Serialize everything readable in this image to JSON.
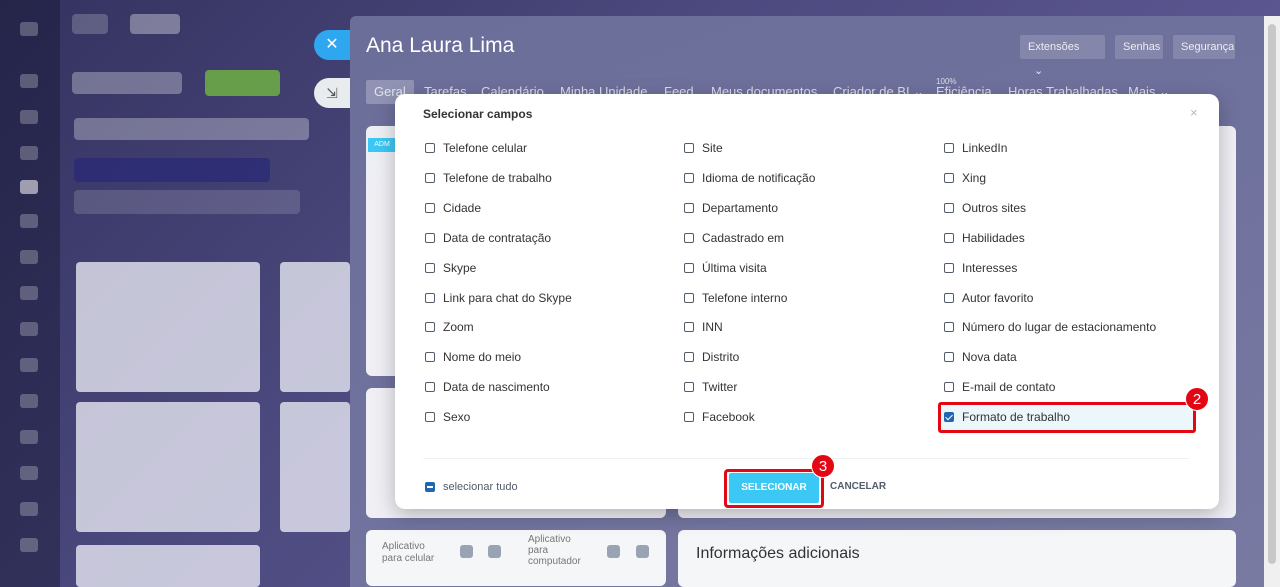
{
  "user": {
    "name": "Ana Laura Lima"
  },
  "header_buttons": {
    "extensoes": "Extensões",
    "extensoes_arrow": "⌄",
    "senhas": "Senhas",
    "seguranca": "Segurança"
  },
  "tabs": [
    "Geral",
    "Tarefas",
    "Calendário",
    "Minha Unidade",
    "Feed",
    "Meus documentos",
    "Criador de BI ⌄",
    "Eficiência",
    "Horas Trabalhadas",
    "Mais ⌄"
  ],
  "efficiency_pct": "100%",
  "admin_badge": "ADM",
  "apps": {
    "mobile": "Aplicativo para celular",
    "desktop": "Aplicativo para computador"
  },
  "info_title": "Informações adicionais",
  "modal": {
    "title": "Selecionar campos",
    "close": "×",
    "columns": [
      [
        {
          "label": "Telefone celular",
          "checked": false
        },
        {
          "label": "Telefone de trabalho",
          "checked": false
        },
        {
          "label": "Cidade",
          "checked": false
        },
        {
          "label": "Data de contratação",
          "checked": false
        },
        {
          "label": "Skype",
          "checked": false
        },
        {
          "label": "Link para chat do Skype",
          "checked": false
        },
        {
          "label": "Zoom",
          "checked": false
        },
        {
          "label": "Nome do meio",
          "checked": false
        },
        {
          "label": "Data de nascimento",
          "checked": false
        },
        {
          "label": "Sexo",
          "checked": false
        }
      ],
      [
        {
          "label": "Site",
          "checked": false
        },
        {
          "label": "Idioma de notificação",
          "checked": false
        },
        {
          "label": "Departamento",
          "checked": false
        },
        {
          "label": "Cadastrado em",
          "checked": false
        },
        {
          "label": "Última visita",
          "checked": false
        },
        {
          "label": "Telefone interno",
          "checked": false
        },
        {
          "label": "INN",
          "checked": false
        },
        {
          "label": "Distrito",
          "checked": false
        },
        {
          "label": "Twitter",
          "checked": false
        },
        {
          "label": "Facebook",
          "checked": false
        }
      ],
      [
        {
          "label": "LinkedIn",
          "checked": false
        },
        {
          "label": "Xing",
          "checked": false
        },
        {
          "label": "Outros sites",
          "checked": false
        },
        {
          "label": "Habilidades",
          "checked": false
        },
        {
          "label": "Interesses",
          "checked": false
        },
        {
          "label": "Autor favorito",
          "checked": false
        },
        {
          "label": "Número do lugar de estacionamento",
          "checked": false
        },
        {
          "label": "Nova data",
          "checked": false
        },
        {
          "label": "E-mail de contato",
          "checked": false
        },
        {
          "label": "Formato de trabalho",
          "checked": true
        }
      ]
    ],
    "select_all": "selecionar tudo",
    "select_button": "SELECIONAR",
    "cancel_button": "CANCELAR"
  },
  "step_badges": {
    "two": "2",
    "three": "3"
  },
  "colors": {
    "accent": "#3bc8f5",
    "highlight": "#e30613",
    "checkbox": "#2067b0"
  }
}
